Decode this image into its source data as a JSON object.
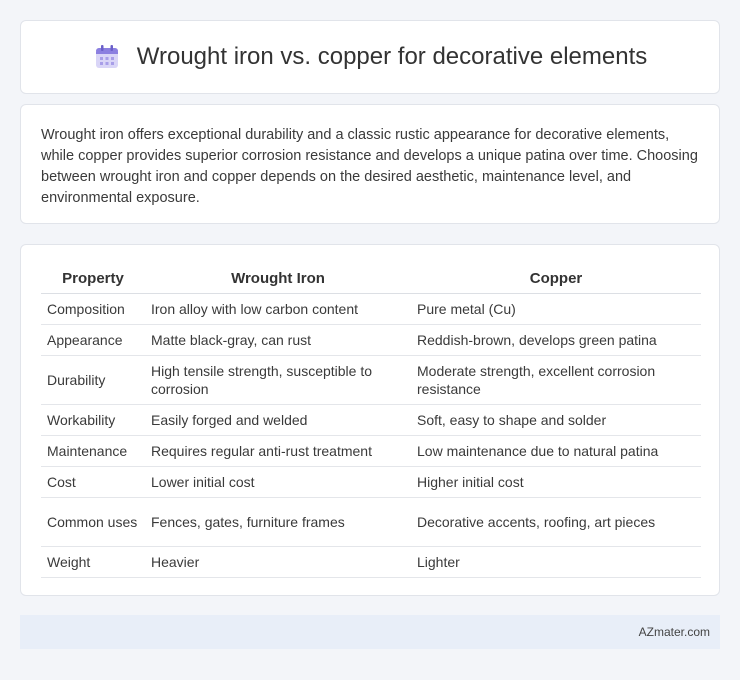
{
  "header": {
    "icon": "calendar-icon",
    "title": "Wrought iron vs. copper for decorative elements"
  },
  "intro": {
    "text": "Wrought iron offers exceptional durability and a classic rustic appearance for decorative elements, while copper provides superior corrosion resistance and develops a unique patina over time. Choosing between wrought iron and copper depends on the desired aesthetic, maintenance level, and environmental exposure."
  },
  "table": {
    "headers": [
      "Property",
      "Wrought Iron",
      "Copper"
    ],
    "rows": [
      [
        "Composition",
        "Iron alloy with low carbon content",
        "Pure metal (Cu)"
      ],
      [
        "Appearance",
        "Matte black-gray, can rust",
        "Reddish-brown, develops green patina"
      ],
      [
        "Durability",
        "High tensile strength, susceptible to corrosion",
        "Moderate strength, excellent corrosion resistance"
      ],
      [
        "Workability",
        "Easily forged and welded",
        "Soft, easy to shape and solder"
      ],
      [
        "Maintenance",
        "Requires regular anti-rust treatment",
        "Low maintenance due to natural patina"
      ],
      [
        "Cost",
        "Lower initial cost",
        "Higher initial cost"
      ],
      [
        "Common uses",
        "Fences, gates, furniture frames",
        "Decorative accents, roofing, art pieces"
      ],
      [
        "Weight",
        "Heavier",
        "Lighter"
      ]
    ]
  },
  "footer": {
    "brand": "AZmater.com"
  },
  "colors": {
    "page_bg": "#f3f5f9",
    "footer_bg": "#e8eef8",
    "icon_accent": "#8b7fe0"
  }
}
